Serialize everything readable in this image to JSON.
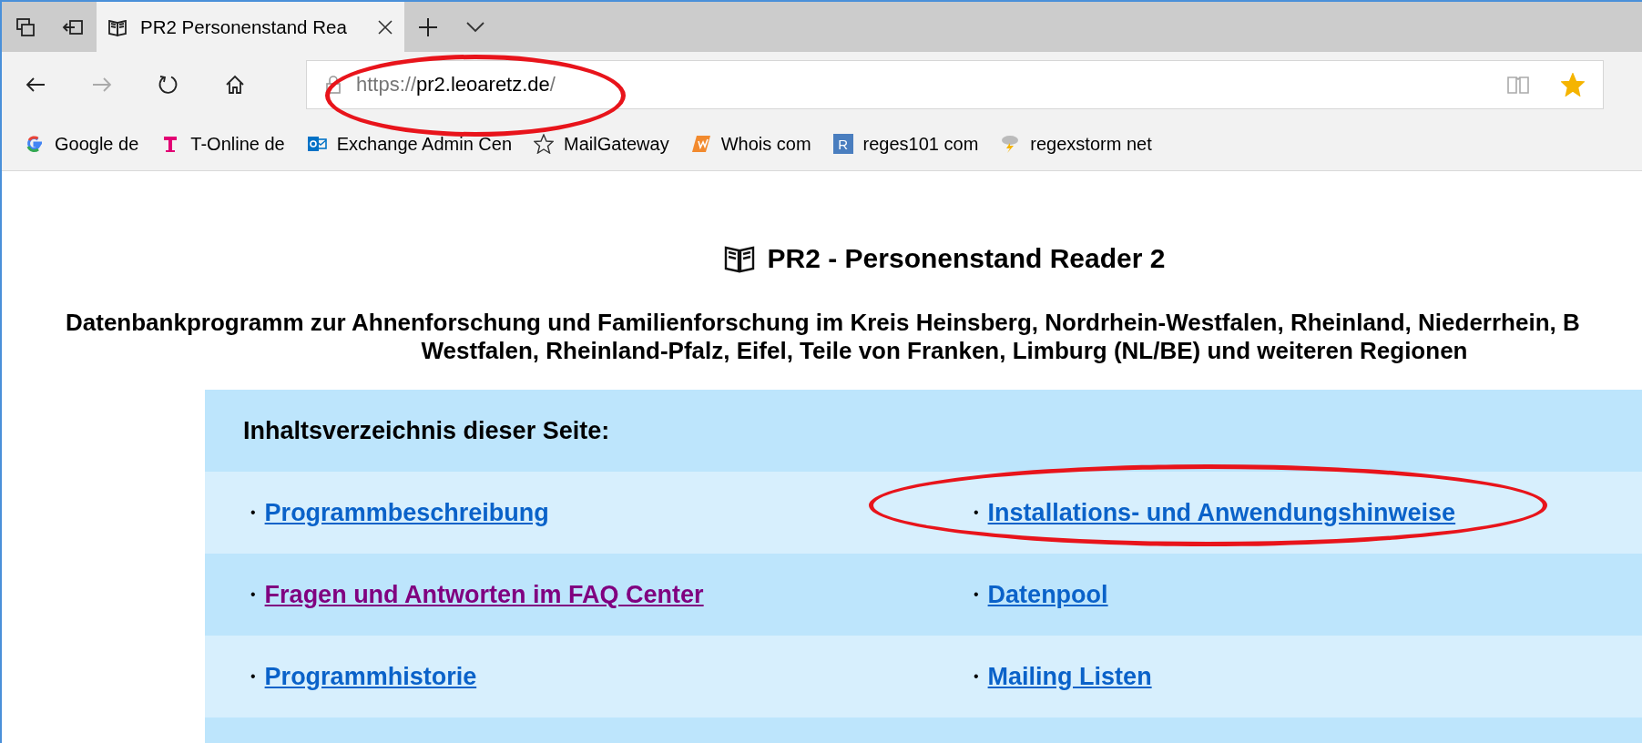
{
  "browser": {
    "tab": {
      "title": "PR2 Personenstand Rea",
      "selected": true
    },
    "address": {
      "scheme": "https://",
      "host": "pr2.leoaretz.de",
      "path": "/",
      "highlighted": true
    },
    "favorited": true,
    "bookmarks": [
      {
        "kind": "google",
        "label": "Google de"
      },
      {
        "kind": "telekom",
        "label": "T-Online de"
      },
      {
        "kind": "outlook",
        "label": "Exchange Admin Cen"
      },
      {
        "kind": "star",
        "label": "MailGateway"
      },
      {
        "kind": "whois",
        "label": "Whois com"
      },
      {
        "kind": "letter",
        "letter": "R",
        "label": "reges101 com"
      },
      {
        "kind": "storm",
        "label": "regexstorm net"
      }
    ]
  },
  "page": {
    "title": "PR2 - Personenstand Reader 2",
    "subtitle_lines": [
      "Datenbankprogramm zur Ahnenforschung und Familienforschung im Kreis Heinsberg, Nordrhein-Westfalen, Rheinland, Niederrhein, B",
      "Westfalen, Rheinland-Pfalz, Eifel, Teile von Franken, Limburg (NL/BE) und weiteren Regionen"
    ],
    "toc": {
      "heading": "Inhaltsverzeichnis dieser Seite:",
      "rows": [
        [
          {
            "bullet": "•",
            "label": "Programmbeschreibung",
            "visited": false,
            "highlighted": false
          },
          {
            "bullet": "•",
            "label": "Installations- und Anwendungshinweise",
            "visited": false,
            "highlighted": true
          }
        ],
        [
          {
            "bullet": "•",
            "label": "Fragen und Antworten im FAQ Center",
            "visited": true,
            "highlighted": false
          },
          {
            "bullet": "•",
            "label": "Datenpool",
            "visited": false,
            "highlighted": false
          }
        ],
        [
          {
            "bullet": "•",
            "label": "Programmhistorie",
            "visited": false,
            "highlighted": false
          },
          {
            "bullet": "•",
            "label": "Mailing Listen",
            "visited": false,
            "highlighted": false
          }
        ]
      ]
    }
  }
}
